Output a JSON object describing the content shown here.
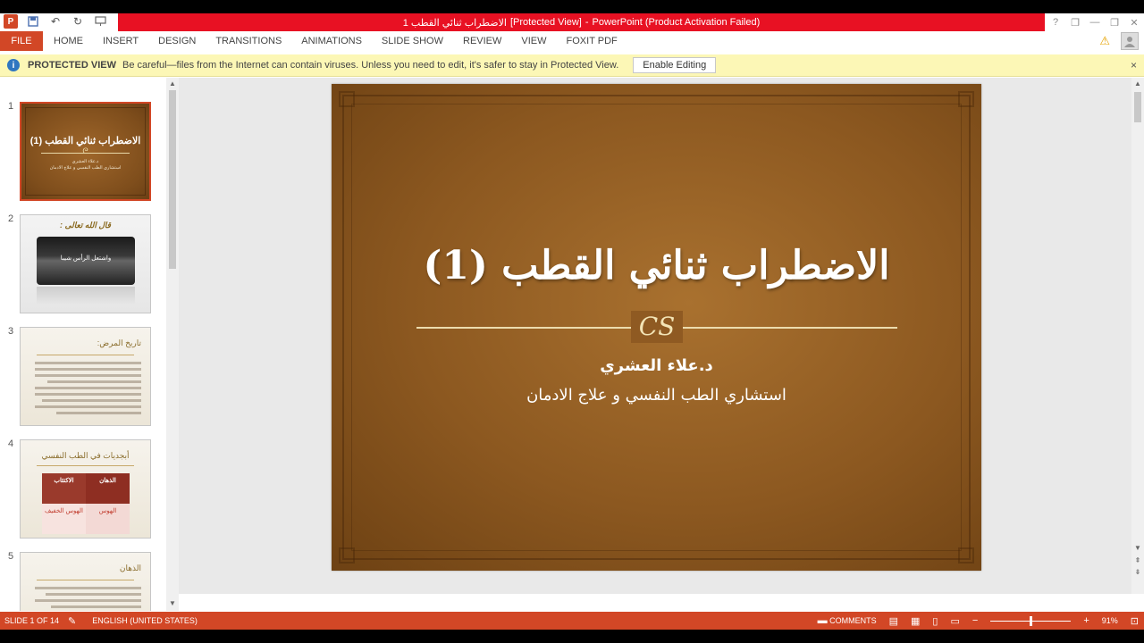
{
  "window": {
    "title_doc": "الاضطراب ثنائي القطب 1",
    "title_mode": "[Protected View]",
    "title_app": "PowerPoint (Product Activation Failed)",
    "controls": [
      "?",
      "❐",
      "—",
      "❐",
      "✕"
    ]
  },
  "qat": {
    "icons": [
      "powerpoint-logo-icon",
      "save-icon",
      "undo-icon",
      "redo-icon",
      "present-icon"
    ]
  },
  "ribbon": {
    "file": "FILE",
    "tabs": [
      "HOME",
      "INSERT",
      "DESIGN",
      "TRANSITIONS",
      "ANIMATIONS",
      "SLIDE SHOW",
      "REVIEW",
      "VIEW",
      "FOXIT PDF"
    ]
  },
  "protected_bar": {
    "label": "PROTECTED VIEW",
    "message": "Be careful—files from the Internet can contain viruses. Unless you need to edit, it's safer to stay in Protected View.",
    "button": "Enable Editing",
    "close": "×"
  },
  "thumbnails": [
    {
      "num": "1",
      "title": "الاضطراب ثنائي القطب (1)",
      "sub1": "د.علاء العشري",
      "sub2": "استشاري الطب النفسي و علاج الادمان"
    },
    {
      "num": "2",
      "title": "قال الله تعالى :",
      "image_text": "واشتعل الرأس شيبا"
    },
    {
      "num": "3",
      "title": "تاريخ المرض:"
    },
    {
      "num": "4",
      "title": "أبجديات في الطب النفسي",
      "cells": [
        "الذهان",
        "الاكتئاب",
        "الهوس",
        "الهوس الخفيف"
      ]
    },
    {
      "num": "5",
      "title": "الذهان"
    }
  ],
  "slide": {
    "title": "الاضطراب ثنائي القطب (1)",
    "ornament": "CS",
    "author": "د.علاء العشري",
    "role": "استشاري الطب النفسي و علاج الادمان"
  },
  "status": {
    "slide": "SLIDE 1 OF 14",
    "language": "ENGLISH (UNITED STATES)",
    "comments": "COMMENTS",
    "zoom": "91%",
    "zoom_fraction": 0.5
  },
  "colors": {
    "accent": "#d24726",
    "title_red": "#e81123",
    "protected_bg": "#fcf7b6"
  }
}
